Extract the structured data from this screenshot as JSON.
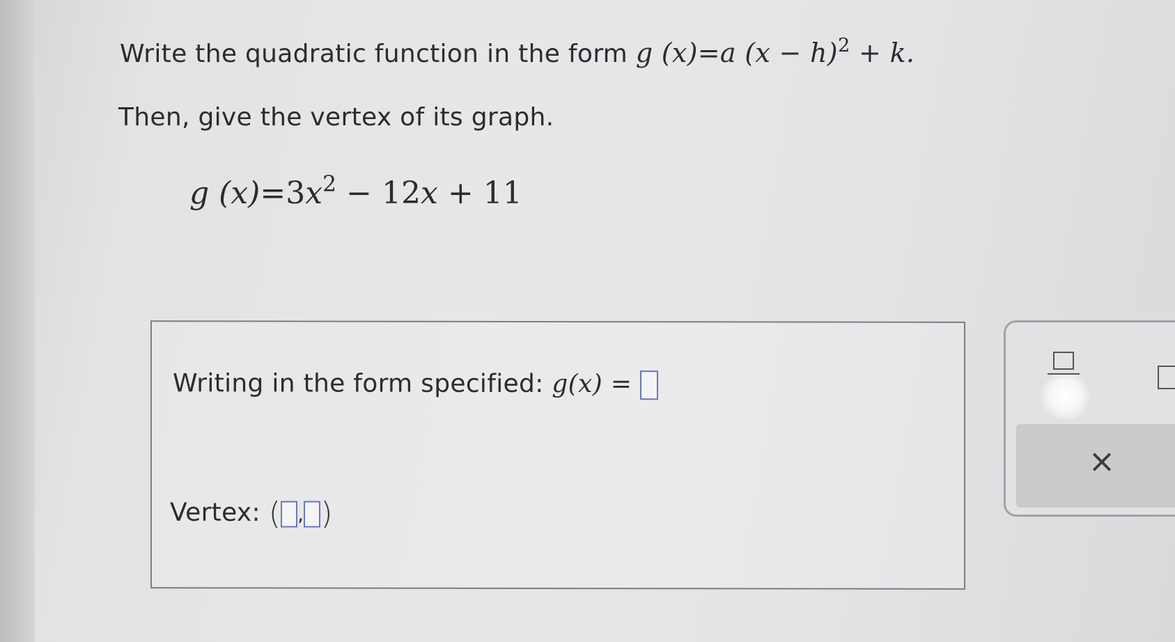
{
  "question": {
    "line1_prefix": "Write the quadratic function in the form",
    "form_expression": {
      "lhs": "g (x)",
      "equals": "=",
      "rhs_a": "a",
      "rhs_paren": "(x − h)",
      "rhs_exp": "2",
      "rhs_tail": "+ k."
    },
    "line2": "Then, give the vertex of its graph.",
    "given": {
      "lhs": "g (x)",
      "equals": "=",
      "coef": "3",
      "var": "x",
      "exp": "2",
      "rest": "− 12",
      "rest_var": "x",
      "rest_tail": "+ 11"
    }
  },
  "answer": {
    "form_label": "Writing in the form specified:",
    "form_func": "g",
    "form_arg": "(x)",
    "form_equals": "=",
    "vertex_label": "Vertex:",
    "vertex_open": "(",
    "vertex_comma": ",",
    "vertex_close": ")"
  },
  "keypad": {
    "clear_symbol": "×",
    "buttons": [
      "fraction-button",
      "square-bracket-button",
      "clear-button"
    ]
  }
}
